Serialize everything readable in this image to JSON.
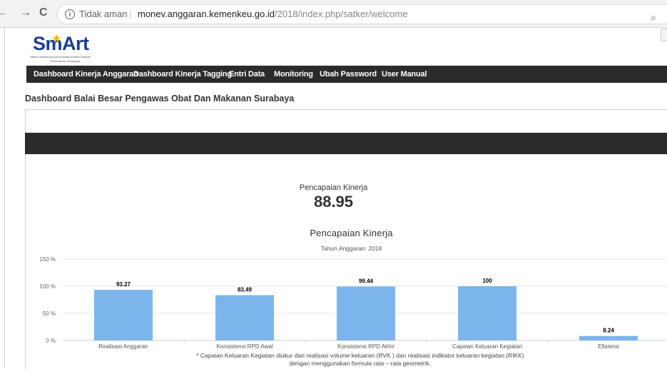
{
  "browser": {
    "back_glyph": "←",
    "forward_glyph": "→",
    "reload_glyph": "C",
    "info_glyph": "i",
    "security_text": "Tidak aman",
    "separator": "|",
    "url_host": "monev.anggaran.kemenkeu.go.id",
    "url_path": "/2018/index.php/satker/welcome",
    "zoom_glyph": "⌕"
  },
  "logo": {
    "brand_pre": "Sm",
    "brand_a": "A",
    "brand_post": "rt",
    "star_glyph": "★",
    "tagline_1": "Sistem Monitoring dan Evaluasi Kinerja Terpadu",
    "tagline_2": "Kementerian Keuangan"
  },
  "menu": [
    {
      "label": "Dashboard Kinerja Anggaran"
    },
    {
      "label": "Dashboard Kinerja Tagging"
    },
    {
      "label": "Entri Data"
    },
    {
      "label": "Monitoring"
    },
    {
      "label": "Ubah Password"
    },
    {
      "label": "User Manual"
    }
  ],
  "page": {
    "title": "Dashboard Balai Besar Pengawas Obat Dan Makanan Surabaya",
    "kpi_label": "Pencapaian Kinerja",
    "kpi_value": "88.95"
  },
  "chart_data": {
    "type": "bar",
    "title": "Pencapaian Kinerja",
    "subtitle": "Tahun Anggaran: 2018",
    "categories": [
      "Realisasi Anggaran",
      "Konsistensi RPD Awal",
      "Konsistensi RPD Akhir",
      "Capaian Keluaran Kegiatan",
      "Efisiensi"
    ],
    "values": [
      93.27,
      83.49,
      99.44,
      100,
      8.24
    ],
    "data_labels": [
      "93.27",
      "83.49",
      "99.44",
      "100",
      "8.24"
    ],
    "ylim": [
      0,
      150
    ],
    "yticks": [
      "0 %",
      "50 %",
      "100 %",
      "150 %"
    ],
    "bar_color": "#7cb5ec",
    "grid": true,
    "footnote_1": "* Capaian Keluaran Kegiatan diukur dari realisasi volume keluaran (RVK ) dan realisasi indikator keluaran kegiatan (RIKK)",
    "footnote_2": "dengan menggunakan formula rata – rata geometrik."
  }
}
